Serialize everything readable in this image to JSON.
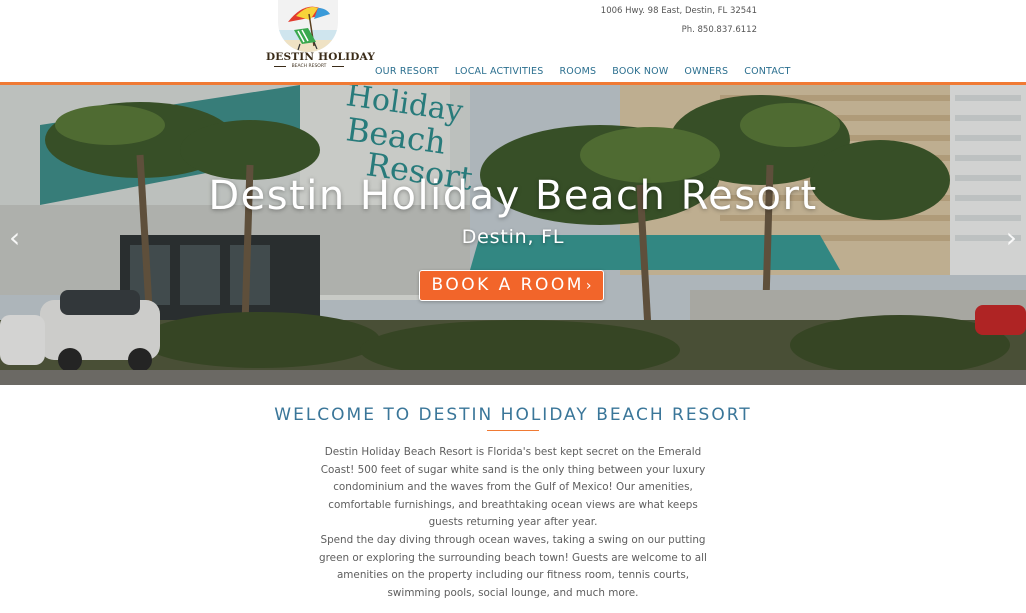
{
  "logo": {
    "name": "DESTIN HOLIDAY",
    "sub": "BEACH RESORT"
  },
  "contact": {
    "address": "1006 Hwy. 98 East, Destin, FL 32541",
    "phone": "Ph. 850.837.6112"
  },
  "nav": {
    "items": [
      {
        "label": "OUR RESORT"
      },
      {
        "label": "LOCAL ACTIVITIES"
      },
      {
        "label": "ROOMS"
      },
      {
        "label": "BOOK NOW"
      },
      {
        "label": "OWNERS"
      },
      {
        "label": "CONTACT"
      }
    ]
  },
  "hero": {
    "title": "Destin Holiday Beach Resort",
    "subtitle": "Destin, FL",
    "button": "BOOK A ROOM",
    "button_chevron": "›",
    "prev_arrow": "‹",
    "next_arrow": "›",
    "building_sign": [
      "Holiday",
      "Beach",
      "Resort"
    ]
  },
  "welcome": {
    "title": "WELCOME TO DESTIN HOLIDAY BEACH RESORT",
    "paragraph1": "Destin Holiday Beach Resort is Florida's best kept secret on the Emerald Coast! 500 feet of sugar white sand is the only thing between your luxury condominium and the waves from the Gulf of Mexico! Our amenities, comfortable furnishings, and breathtaking ocean views are what keeps guests returning year after year.",
    "paragraph2": "Spend the day diving through ocean waves, taking a swing on our putting green or exploring the surrounding beach town! Guests are welcome to all amenities on the property including our fitness room, tennis courts, swimming pools, social lounge, and much more."
  },
  "colors": {
    "accent_orange": "#f2652a",
    "nav_blue": "#2b6f8f",
    "heading_blue": "#3a7699"
  }
}
